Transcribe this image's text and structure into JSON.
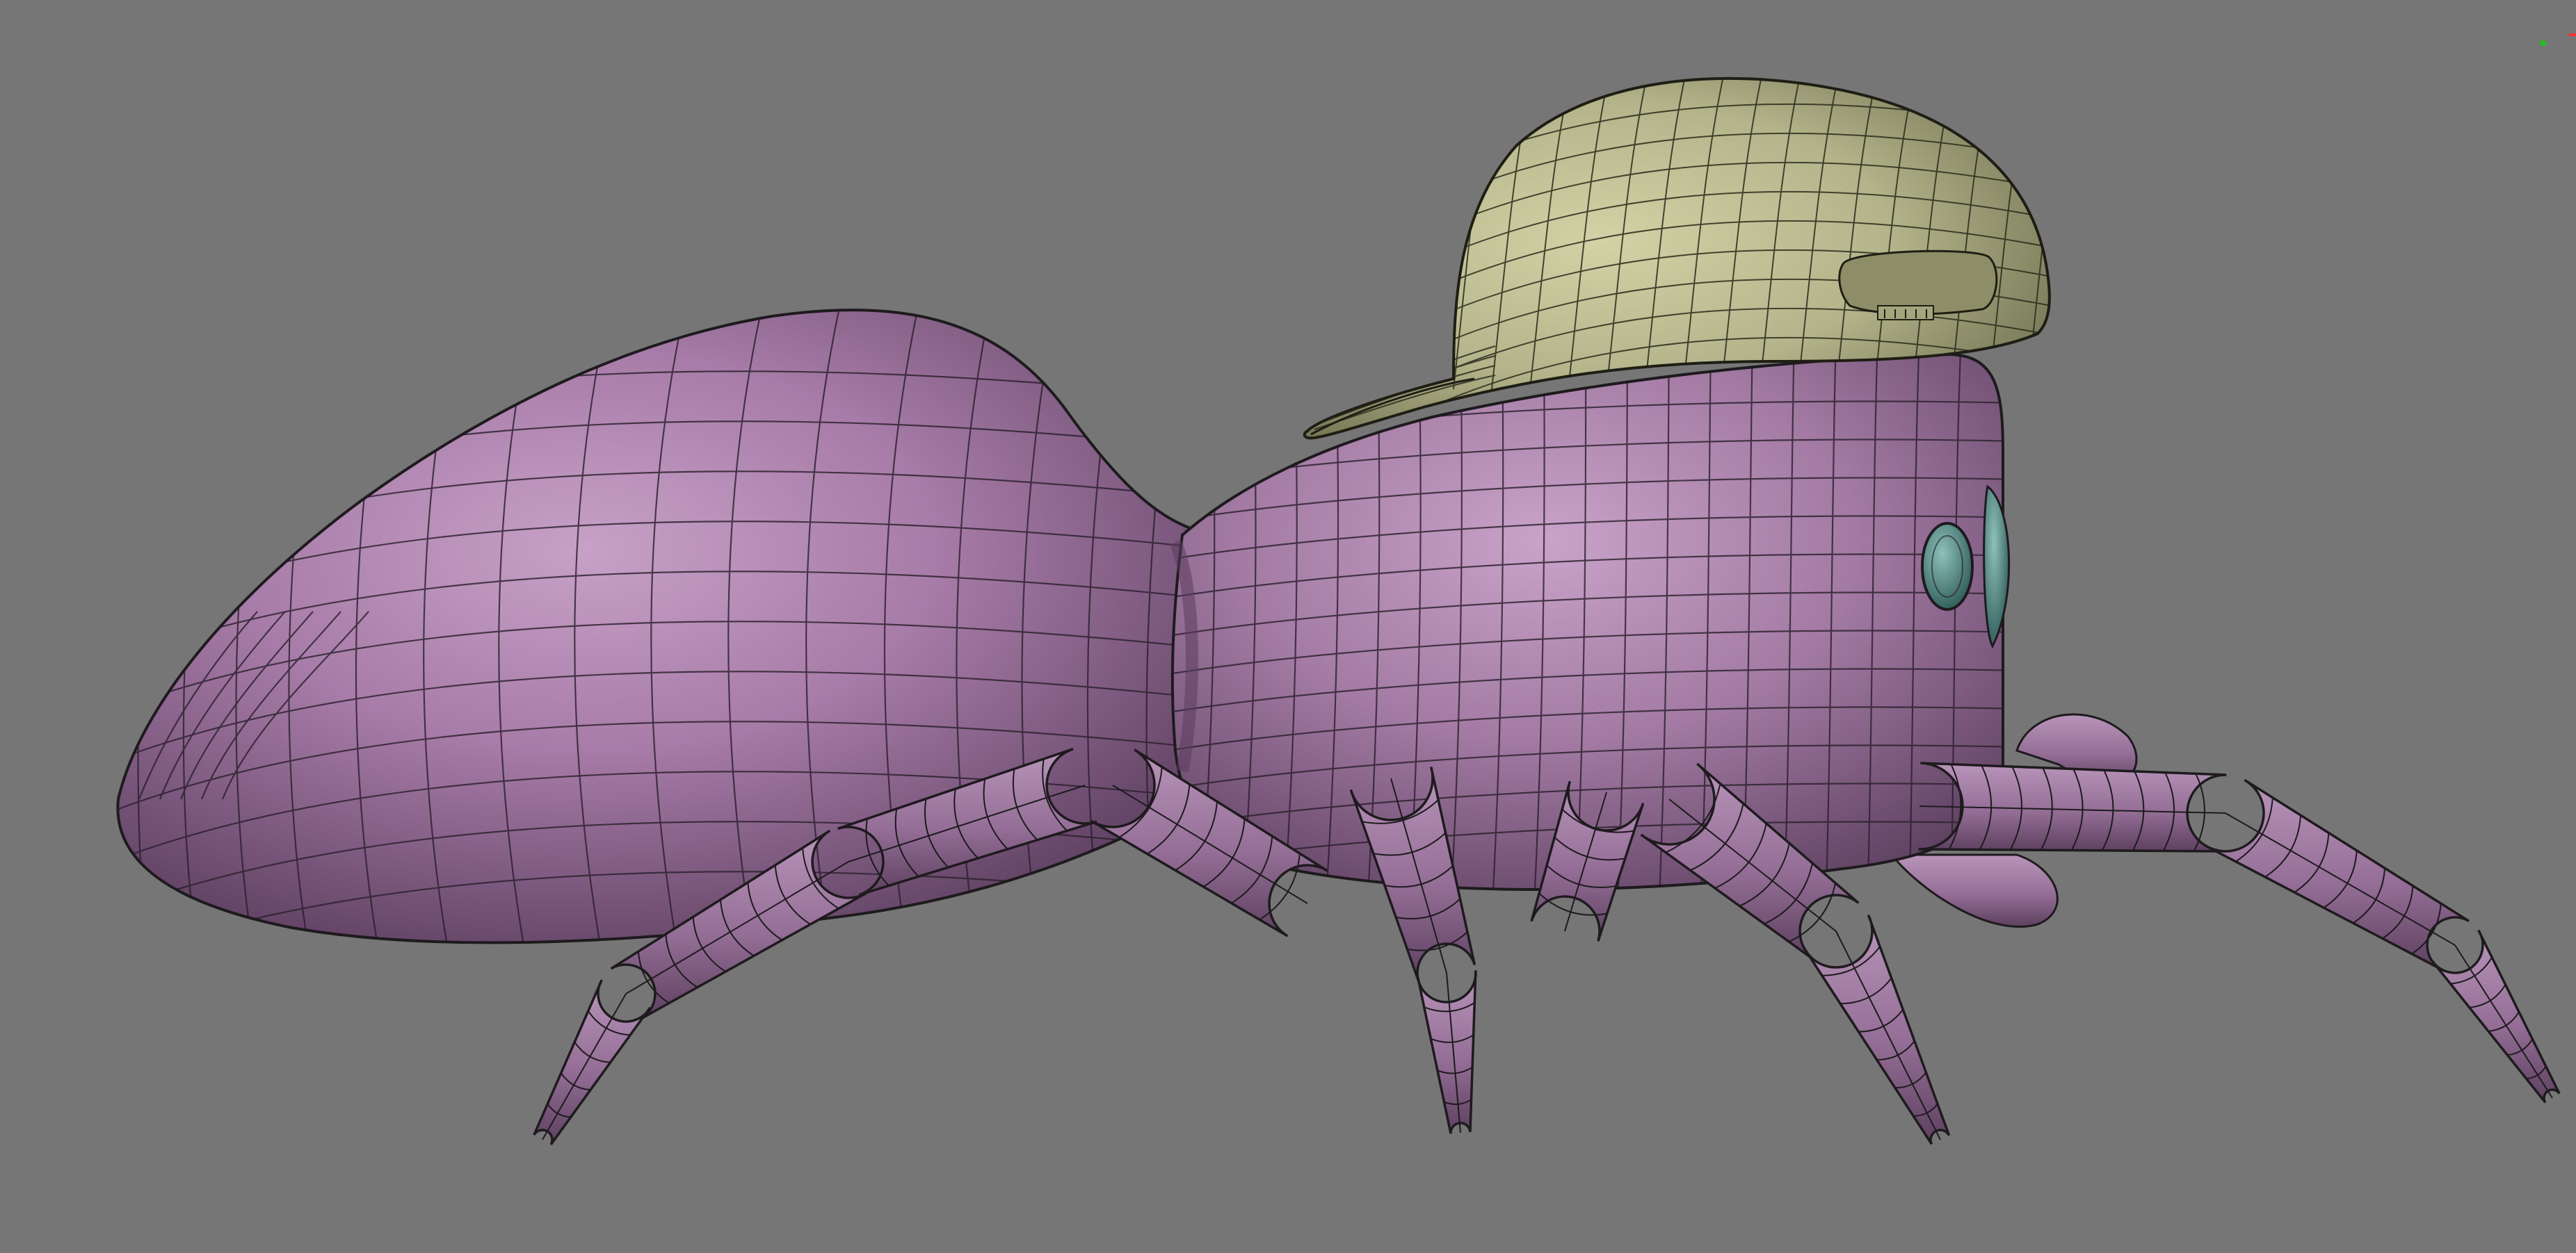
{
  "viewport": {
    "background_color": "#767676",
    "shading": "smooth-with-wireframe-overlay"
  },
  "model": {
    "subject": "cartoon-spider",
    "parts": [
      {
        "name": "abdomen",
        "color": "#9c6f9c"
      },
      {
        "name": "cephalothorax",
        "color": "#9c6f9c"
      },
      {
        "name": "legs",
        "count": 8,
        "color": "#9c6f9c"
      },
      {
        "name": "eyes",
        "color": "#4e8784"
      },
      {
        "name": "baseball-cap",
        "color": "#b3b48a"
      }
    ],
    "wire_color": "#1e1a1e"
  },
  "axis_gizmo": {
    "x_color": "#ff3030",
    "y_color": "#20c020"
  }
}
